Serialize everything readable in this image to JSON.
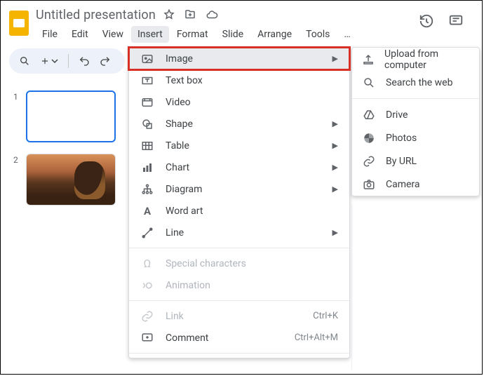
{
  "header": {
    "doc_title": "Untitled presentation",
    "menubar": [
      "File",
      "Edit",
      "View",
      "Insert",
      "Format",
      "Slide",
      "Arrange",
      "Tools",
      "…"
    ],
    "active_menu_index": 3
  },
  "thumbs": [
    {
      "num": "1",
      "selected": true,
      "content": "blank"
    },
    {
      "num": "2",
      "selected": false,
      "content": "photo"
    }
  ],
  "insert_menu": {
    "groups": [
      [
        {
          "id": "image",
          "label": "Image",
          "icon": "image-icon",
          "submenu": true,
          "highlight": true,
          "outlined": true
        },
        {
          "id": "textbox",
          "label": "Text box",
          "icon": "textbox-icon"
        },
        {
          "id": "video",
          "label": "Video",
          "icon": "video-icon"
        },
        {
          "id": "shape",
          "label": "Shape",
          "icon": "shape-icon",
          "submenu": true
        },
        {
          "id": "table",
          "label": "Table",
          "icon": "table-icon",
          "submenu": true
        },
        {
          "id": "chart",
          "label": "Chart",
          "icon": "chart-icon",
          "submenu": true
        },
        {
          "id": "diagram",
          "label": "Diagram",
          "icon": "diagram-icon",
          "submenu": true
        },
        {
          "id": "wordart",
          "label": "Word art",
          "icon": "wordart-icon"
        },
        {
          "id": "line",
          "label": "Line",
          "icon": "line-icon",
          "submenu": true
        }
      ],
      [
        {
          "id": "special",
          "label": "Special characters",
          "icon": "omega-icon",
          "disabled": true
        },
        {
          "id": "anim",
          "label": "Animation",
          "icon": "motion-icon",
          "disabled": true
        }
      ],
      [
        {
          "id": "link",
          "label": "Link",
          "icon": "link-icon",
          "disabled": true,
          "shortcut": "Ctrl+K"
        },
        {
          "id": "comment",
          "label": "Comment",
          "icon": "comment-icon",
          "shortcut": "Ctrl+Alt+M"
        }
      ]
    ]
  },
  "image_submenu": {
    "groups": [
      [
        {
          "id": "upload",
          "label": "Upload from computer",
          "icon": "upload-icon"
        },
        {
          "id": "search",
          "label": "Search the web",
          "icon": "search-icon"
        }
      ],
      [
        {
          "id": "drive",
          "label": "Drive",
          "icon": "drive-icon"
        },
        {
          "id": "photos",
          "label": "Photos",
          "icon": "photos-icon"
        },
        {
          "id": "byurl",
          "label": "By URL",
          "icon": "url-icon"
        },
        {
          "id": "camera",
          "label": "Camera",
          "icon": "camera-icon"
        }
      ]
    ]
  }
}
